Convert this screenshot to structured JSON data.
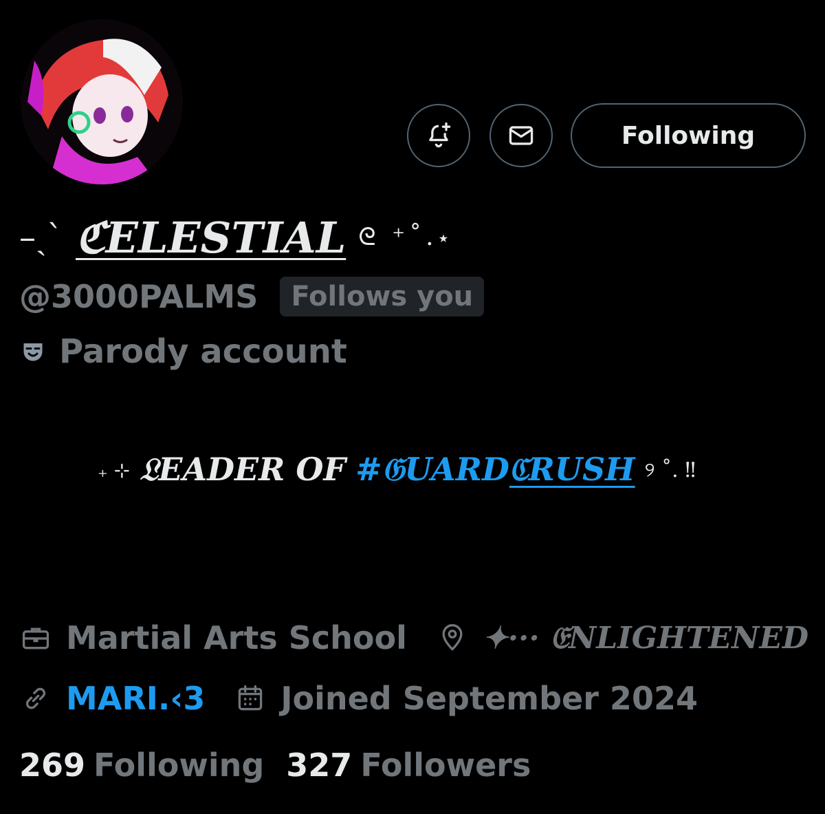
{
  "profile": {
    "display_name_prefix": "–ˏˋ",
    "display_name": "ℭELESTIAL",
    "display_name_suffix": "ᘓ ⁺˚.⋆",
    "handle": "@3000PALMS",
    "follows_you": "Follows you",
    "parody_label": "Parody account"
  },
  "actions": {
    "following_label": "Following"
  },
  "bio": {
    "prefix": "₊ ⊹",
    "text": "𝔏EADER OF",
    "hashtag_start": "#𝔊UARD",
    "hashtag_underlined": "ℭRUSH",
    "suffix": "୨ ˚. ‼"
  },
  "meta": {
    "profession": "Martial Arts School",
    "location": "✦··· 𝔈NLIGHTENED",
    "link": "MARI.‹3",
    "joined": "Joined September 2024"
  },
  "stats": {
    "following_count": "269",
    "following_label": "Following",
    "followers_count": "327",
    "followers_label": "Followers"
  },
  "colors": {
    "background": "#000000",
    "primary_text": "#e7e9ea",
    "secondary_text": "#71767b",
    "accent": "#1d9bf0",
    "border": "#536471"
  },
  "icons": {
    "notify": "bell-plus-icon",
    "message": "envelope-icon",
    "parody": "theater-mask-icon",
    "profession": "briefcase-icon",
    "location": "map-pin-icon",
    "link": "link-icon",
    "joined": "calendar-icon"
  }
}
